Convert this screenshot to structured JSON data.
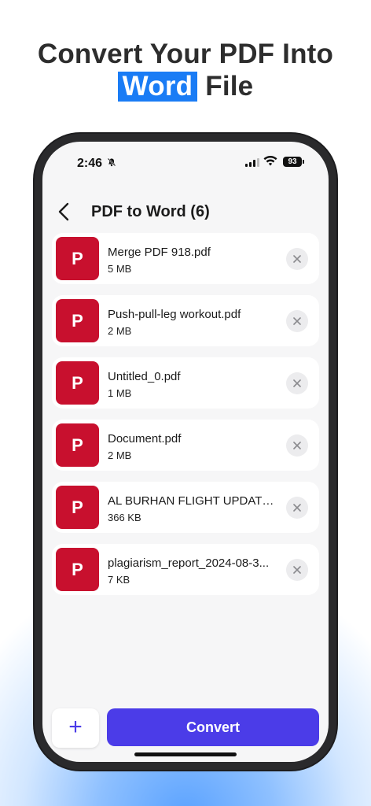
{
  "headline": {
    "line1": "Convert Your PDF Into",
    "highlight": "Word",
    "line2_rest": "File"
  },
  "status_bar": {
    "time": "2:46",
    "battery": "93"
  },
  "header": {
    "title": "PDF to Word (6)"
  },
  "files": [
    {
      "icon_letter": "P",
      "name": "Merge PDF 918.pdf",
      "size": "5 MB"
    },
    {
      "icon_letter": "P",
      "name": "Push-pull-leg workout.pdf",
      "size": "2 MB"
    },
    {
      "icon_letter": "P",
      "name": "Untitled_0.pdf",
      "size": "1 MB"
    },
    {
      "icon_letter": "P",
      "name": "Document.pdf",
      "size": "2 MB"
    },
    {
      "icon_letter": "P",
      "name": "AL BURHAN FLIGHT UPDATE....",
      "size": "366 KB"
    },
    {
      "icon_letter": "P",
      "name": "plagiarism_report_2024-08-3...",
      "size": "7 KB"
    }
  ],
  "footer": {
    "add_label": "+",
    "convert_label": "Convert"
  },
  "icons": {
    "back": "chevron-left-icon",
    "remove": "close-icon",
    "bell": "bell-slash-icon",
    "wifi": "wifi-icon",
    "signal": "cellular-signal-icon"
  },
  "colors": {
    "highlight": "#1a7cf5",
    "pdf_icon": "#c8102e",
    "accent": "#4b3ce8"
  }
}
